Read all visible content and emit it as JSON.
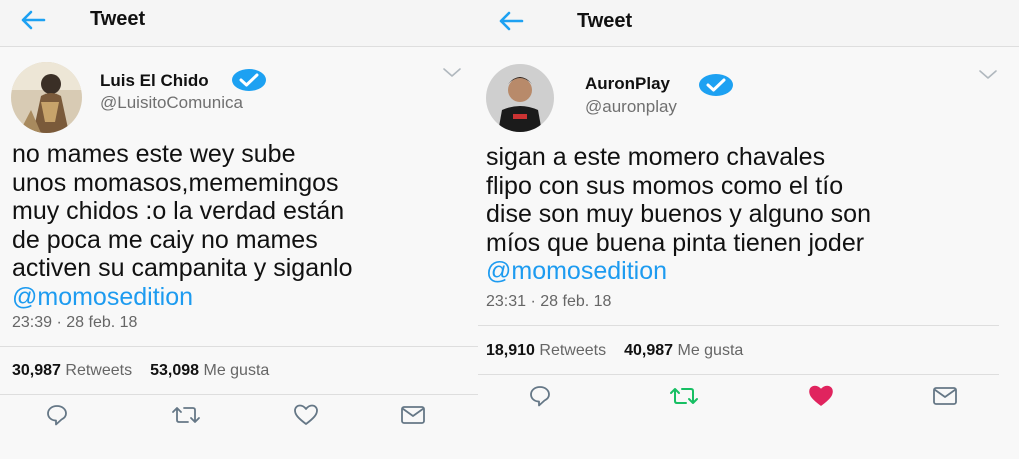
{
  "tweets": [
    {
      "header_title": "Tweet",
      "display_name": "Luis El Chido",
      "handle": "@LuisitoComunica",
      "body_lines": [
        "no mames este wey sube",
        "unos momasos,mememingos",
        "muy chidos :o la verdad están",
        "de poca me caiy no mames",
        "activen su campanita y siganlo"
      ],
      "mention": "@momosedition",
      "timestamp": "23:39 · 28 feb. 18",
      "retweets_count": "30,987",
      "retweets_label": "Retweets",
      "likes_count": "53,098",
      "likes_label": "Me gusta",
      "retweet_active": false,
      "liked": false
    },
    {
      "header_title": "Tweet",
      "display_name": "AuronPlay",
      "handle": "@auronplay",
      "body_lines": [
        "sigan a este momero chavales",
        "flipo con sus momos como el tío",
        "dise son muy buenos y alguno son",
        "míos que buena pinta tienen joder"
      ],
      "mention": "@momosedition",
      "timestamp": "23:31 · 28 feb. 18",
      "retweets_count": "18,910",
      "retweets_label": "Retweets",
      "likes_count": "40,987",
      "likes_label": "Me gusta",
      "retweet_active": true,
      "liked": true
    }
  ],
  "colors": {
    "accent_blue": "#1da1f2",
    "retweet_green": "#17bf63",
    "like_red": "#e0245e",
    "icon_gray": "#657786"
  }
}
